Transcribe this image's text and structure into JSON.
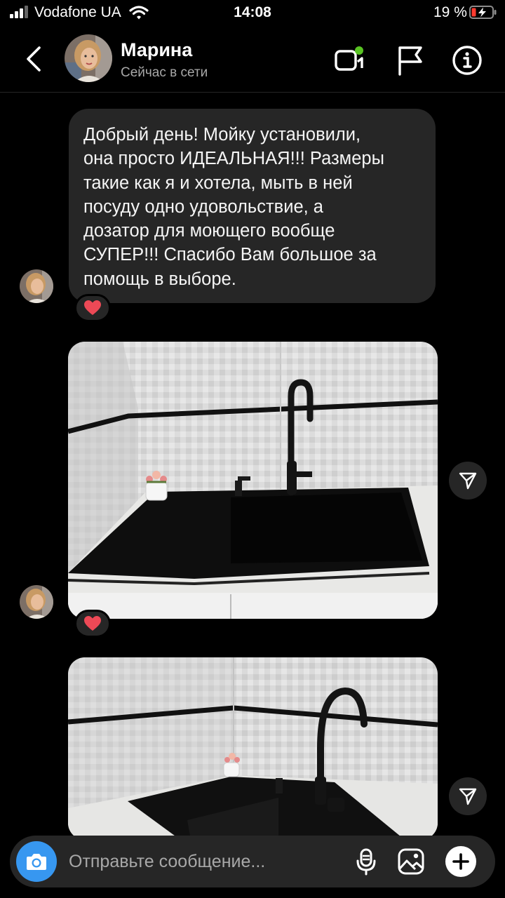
{
  "status_bar": {
    "carrier": "Vodafone UA",
    "time": "14:08",
    "battery_percent": "19 %",
    "icons": [
      "signal-icon",
      "wifi-icon",
      "battery-charging-icon"
    ]
  },
  "header": {
    "contact_name": "Марина",
    "contact_status": "Сейчас в сети",
    "icons": [
      "back-icon",
      "video-call-icon",
      "flag-icon",
      "info-icon"
    ]
  },
  "messages": [
    {
      "type": "text",
      "lines": [
        "Добрый день! Мойку установили,",
        "она просто ИДЕАЛЬНАЯ!!! Размеры",
        "такие как я и хотела, мыть в ней",
        "посуду одно удовольствие, а",
        "дозатор для моющего вообще",
        "СУПЕР!!! Спасибо Вам большое за",
        "помощь в выборе."
      ],
      "reaction": "heart"
    },
    {
      "type": "photo",
      "subject": "black sink with faucet in tiled kitchen",
      "reaction": "heart"
    },
    {
      "type": "photo",
      "subject": "black sink with faucet, second view"
    }
  ],
  "composer": {
    "placeholder": "Отправьте сообщение...",
    "icons": [
      "camera-icon",
      "microphone-icon",
      "gallery-icon",
      "plus-icon"
    ]
  },
  "colors": {
    "background": "#000000",
    "bubble": "#262626",
    "camera_button": "#3797f0",
    "online_dot": "#58c322",
    "battery_low": "#ff3b30",
    "heart": "#ed4956"
  }
}
